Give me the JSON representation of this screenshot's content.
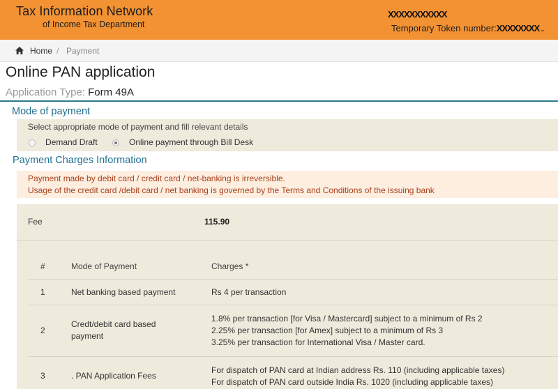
{
  "header": {
    "brand_line1": "Tax Information Network",
    "brand_line2": "of Income Tax Department",
    "username": "XXXXXXXXXXX",
    "token_label": "Temporary Token number:",
    "token_value": "XXXXXXXX",
    "caret": "⌄",
    "bg_color": "#f39233"
  },
  "breadcrumb": {
    "home": "Home",
    "separator": "/",
    "current": "Payment"
  },
  "page": {
    "title": "Online PAN application",
    "app_type_label": "Application Type:",
    "app_type_value": "Form 49A"
  },
  "mode_of_payment": {
    "heading": "Mode of payment",
    "instruction": "Select appropriate mode of payment and fill relevant details",
    "options": [
      {
        "label": "Demand Draft",
        "selected": false
      },
      {
        "label": "Online payment through Bill Desk",
        "selected": true
      }
    ]
  },
  "charges": {
    "heading": "Payment Charges Information",
    "alert_line1": "Payment made by debit card / credit card / net-banking is irreversible.",
    "alert_line2": "Usage of the credit card /debit card / net banking is governed by the Terms and Conditions of the issuing bank",
    "fee_label": "Fee",
    "fee_value": "115.90",
    "table_headers": {
      "num": "#",
      "mode": "Mode of Payment",
      "charges": "Charges *"
    },
    "rows": [
      {
        "num": "1",
        "mode": [
          "Net banking based payment"
        ],
        "charges": [
          "Rs 4 per transaction"
        ]
      },
      {
        "num": "2",
        "mode": [
          "Credt/debit card based",
          "payment"
        ],
        "charges": [
          "1.8% per transaction [for Visa / Mastercard] subject to a minimum of Rs 2",
          "2.25% per transaction [for Amex] subject to a minimum of Rs 3",
          "3.25% per transaction for International Visa / Master card."
        ]
      },
      {
        "num": "3",
        "mode": [
          ". PAN Application Fees"
        ],
        "charges": [
          "For dispatch of PAN card at Indian address Rs. 110 (including applicable taxes)",
          "For dispatch of PAN card outside India Rs. 1020 (including applicable taxes)"
        ]
      }
    ]
  }
}
